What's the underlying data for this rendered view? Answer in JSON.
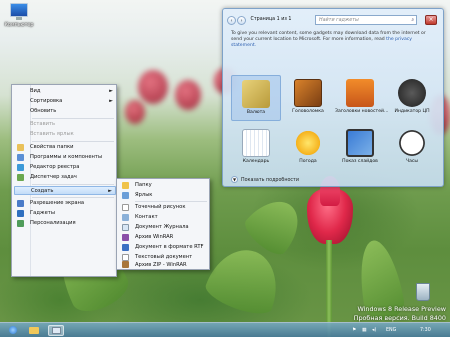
{
  "desktop": {
    "icon_label": "Компьютер",
    "watermark_line1": "Windows 8 Release Preview",
    "watermark_line2": "Пробная версия. Build 8400"
  },
  "context_menu": {
    "items": [
      {
        "label": "Вид",
        "submenu": true,
        "disabled": false
      },
      {
        "label": "Сортировка",
        "submenu": true,
        "disabled": false
      },
      {
        "label": "Обновить",
        "submenu": false,
        "disabled": false
      },
      {
        "label": "Вставить",
        "submenu": false,
        "disabled": true
      },
      {
        "label": "Вставить ярлык",
        "submenu": false,
        "disabled": true
      },
      {
        "label": "Свойства папки",
        "submenu": false,
        "disabled": false
      },
      {
        "label": "Программы и компоненты",
        "submenu": false,
        "disabled": false
      },
      {
        "label": "Редактор реестра",
        "submenu": false,
        "disabled": false
      },
      {
        "label": "Диспетчер задач",
        "submenu": false,
        "disabled": false
      },
      {
        "label": "Создать",
        "submenu": true,
        "disabled": false
      },
      {
        "label": "Разрешение экрана",
        "submenu": false,
        "disabled": false
      },
      {
        "label": "Гаджеты",
        "submenu": false,
        "disabled": false
      },
      {
        "label": "Персонализация",
        "submenu": false,
        "disabled": false
      }
    ]
  },
  "create_submenu": {
    "items": [
      "Папку",
      "Ярлык",
      "Точечный рисунок",
      "Контакт",
      "Документ Журнала",
      "Архив WinRAR",
      "Документ в формате RTF",
      "Текстовый документ",
      "Архив ZIP - WinRAR"
    ]
  },
  "gadget_gallery": {
    "page_label": "Страница 1 из 1",
    "search_placeholder": "Найти гаджеты",
    "notice_text": "To give you relevant content, some gadgets may download data from the internet or send your current location to Microsoft. For more information, read",
    "notice_link": "the privacy statement.",
    "gadgets": [
      {
        "name": "Валюта",
        "selected": true
      },
      {
        "name": "Головоломка",
        "selected": false
      },
      {
        "name": "Заголовки новостей...",
        "selected": false
      },
      {
        "name": "Индикатор ЦП",
        "selected": false
      },
      {
        "name": "Календарь",
        "selected": false
      },
      {
        "name": "Погода",
        "selected": false
      },
      {
        "name": "Показ слайдов",
        "selected": false
      },
      {
        "name": "Часы",
        "selected": false
      }
    ],
    "show_details_label": "Показать подробности"
  },
  "taskbar": {
    "language": "ENG",
    "time": "7:30"
  },
  "colors": {
    "menu_highlight": "#c3dcf7",
    "gallery_bg": "#dbe9f7",
    "taskbar": "#5f8fb0"
  }
}
